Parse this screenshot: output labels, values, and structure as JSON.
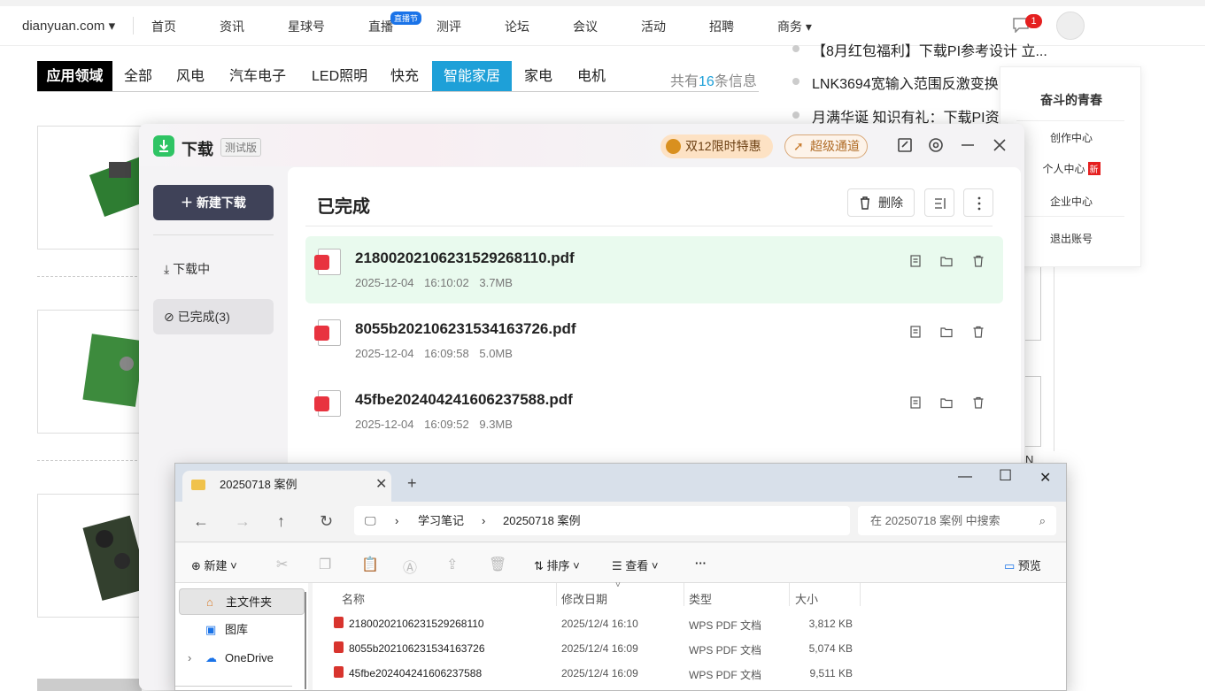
{
  "site": {
    "brand": "dianyuan.com",
    "nav": [
      "首页",
      "资讯",
      "星球号",
      "直播",
      "测评",
      "论坛",
      "会议",
      "活动",
      "招聘",
      "商务"
    ],
    "live_badge": "直播节",
    "msg_count": "1"
  },
  "categories": {
    "label": "应用领域",
    "items": [
      "全部",
      "风电",
      "汽车电子",
      "LED照明",
      "快充",
      "智能家居",
      "家电",
      "电机"
    ],
    "active": "智能家居",
    "count_prefix": "共有",
    "count_num": "16",
    "count_suffix": "条信息"
  },
  "news": [
    "【8月红包福利】下载PI参考设计 立...",
    "LNK3694宽输入范围反激变换",
    "月满华诞 知识有礼：下载PI资"
  ],
  "user_menu": {
    "name": "奋斗的青春",
    "items": [
      "创作中心",
      "个人中心",
      "企业中心",
      "退出账号"
    ],
    "new_badge": "新"
  },
  "download": {
    "title": "下载",
    "beta": "测试版",
    "promo": "双12限时特惠",
    "fast": "超级通道",
    "new_download": "新建下载",
    "nav_downloading": "下载中",
    "nav_done": "已完成(3)",
    "section_title": "已完成",
    "delete_label": "删除",
    "files": [
      {
        "name": "218002021062315292681​10.pdf",
        "date": "2025-12-04",
        "time": "16:10:02",
        "size": "3.7MB"
      },
      {
        "name": "8055b202106231534163726.pdf",
        "date": "2025-12-04",
        "time": "16:09:58",
        "size": "5.0MB"
      },
      {
        "name": "45fbe202404241606237588.pdf",
        "date": "2025-12-04",
        "time": "16:09:52",
        "size": "9.3MB"
      }
    ]
  },
  "explorer": {
    "tab_title": "20250718 案例",
    "breadcrumb": [
      "学习笔记",
      "20250718 案例"
    ],
    "search_placeholder": "在 20250718 案例 中搜索",
    "new_label": "新建",
    "sort_label": "排序",
    "view_label": "查看",
    "preview_label": "预览",
    "nav_items": [
      "主文件夹",
      "图库",
      "OneDrive"
    ],
    "columns": [
      "名称",
      "修改日期",
      "类型",
      "大小"
    ],
    "files": [
      {
        "name": "21800202106231529268110",
        "date": "2025/12/4 16:10",
        "type": "WPS PDF 文档",
        "size": "3,812 KB"
      },
      {
        "name": "8055b202106231534163726",
        "date": "2025/12/4 16:09",
        "type": "WPS PDF 文档",
        "size": "5,074 KB"
      },
      {
        "name": "45fbe202404241606237588",
        "date": "2025/12/4 16:09",
        "type": "WPS PDF 文档",
        "size": "9,511 KB"
      }
    ]
  },
  "colors": {
    "accent": "#1ea0d8",
    "download_dark": "#3f4258",
    "green": "#2fc464",
    "pdf_red": "#e8333f"
  }
}
